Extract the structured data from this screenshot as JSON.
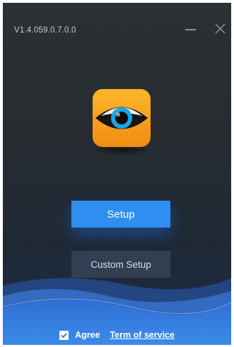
{
  "window": {
    "version": "V1.4.059.0.7.0.0"
  },
  "buttons": {
    "setup_label": "Setup",
    "custom_setup_label": "Custom Setup"
  },
  "footer": {
    "agree_label": "Agree",
    "agree_checked": true,
    "tos_label": "Term of service"
  },
  "icons": {
    "app_logo": "eye-logo-icon",
    "minimize": "minimize-icon",
    "close": "close-icon",
    "check": "check-icon"
  },
  "colors": {
    "accent": "#2f8ff0",
    "logo_orange": "#f7a21d",
    "background": "#2a2f34"
  }
}
